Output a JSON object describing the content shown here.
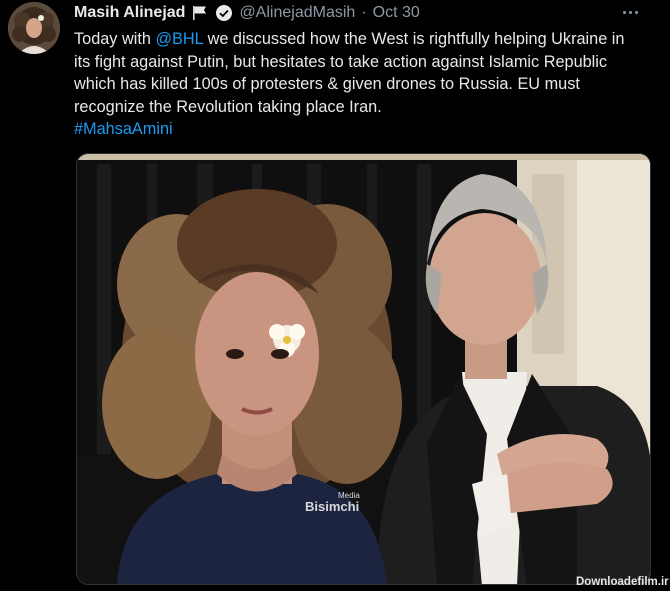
{
  "tweet": {
    "author_name": "Masih Alinejad",
    "handle": "@AlinejadMasih",
    "separator": "·",
    "date": "Oct 30",
    "text": {
      "l1_a": "Today with ",
      "l1_mention": "@BHL",
      "l1_b": " we discussed how the West is rightfully helping Ukraine in",
      "l2": "its fight against Putin, but hesitates to take action against Islamic Republic",
      "l3": "which has killed 100s of protesters & given drones to Russia. EU must",
      "l4": "recognize the Revolution taking place Iran.",
      "hashtag": "#MahsaAmini"
    },
    "image": {
      "watermark_small": "Media",
      "watermark_big": "Bisimchi"
    }
  },
  "watermark": "Downloadefilm.ir",
  "colors": {
    "background": "#000000",
    "text": "#e7e9ea",
    "secondary": "#8b98a5",
    "link": "#1d9bf0"
  }
}
